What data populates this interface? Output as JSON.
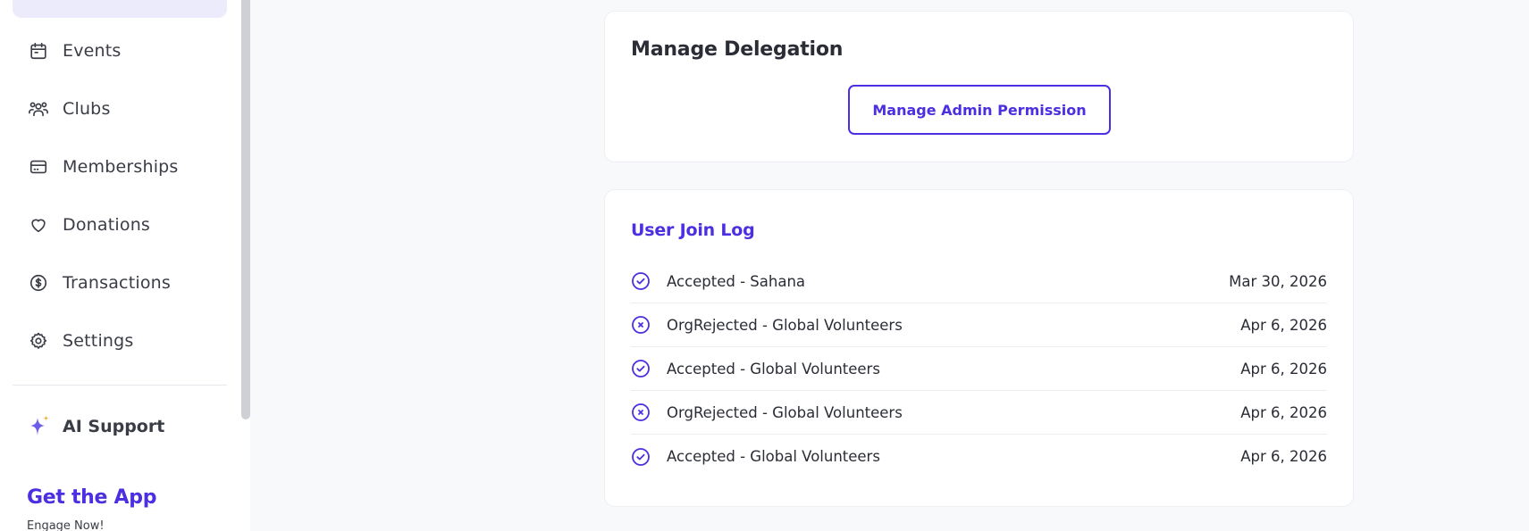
{
  "sidebar": {
    "items": [
      {
        "label": "Events",
        "icon": "calendar-icon"
      },
      {
        "label": "Clubs",
        "icon": "users-group-icon"
      },
      {
        "label": "Memberships",
        "icon": "card-icon"
      },
      {
        "label": "Donations",
        "icon": "heart-icon"
      },
      {
        "label": "Transactions",
        "icon": "dollar-circle-icon"
      },
      {
        "label": "Settings",
        "icon": "gear-icon"
      }
    ],
    "ai_support": {
      "label": "AI Support",
      "icon": "sparkle-icon"
    },
    "get_app": {
      "title": "Get the App",
      "subtitle": "Engage Now!"
    }
  },
  "delegation": {
    "title": "Manage Delegation",
    "button_label": "Manage Admin Permission"
  },
  "join_log": {
    "title": "User Join Log",
    "rows": [
      {
        "status": "accepted",
        "text": "Accepted - Sahana",
        "date": "Mar 30, 2026"
      },
      {
        "status": "rejected",
        "text": "OrgRejected - Global Volunteers",
        "date": "Apr 6, 2026"
      },
      {
        "status": "accepted",
        "text": "Accepted - Global Volunteers",
        "date": "Apr 6, 2026"
      },
      {
        "status": "rejected",
        "text": "OrgRejected - Global Volunteers",
        "date": "Apr 6, 2026"
      },
      {
        "status": "accepted",
        "text": "Accepted - Global Volunteers",
        "date": "Apr 6, 2026"
      }
    ]
  },
  "colors": {
    "accent": "#4b2fe0",
    "sparkle_gold": "#f2b33d",
    "text": "#2b2d36"
  }
}
